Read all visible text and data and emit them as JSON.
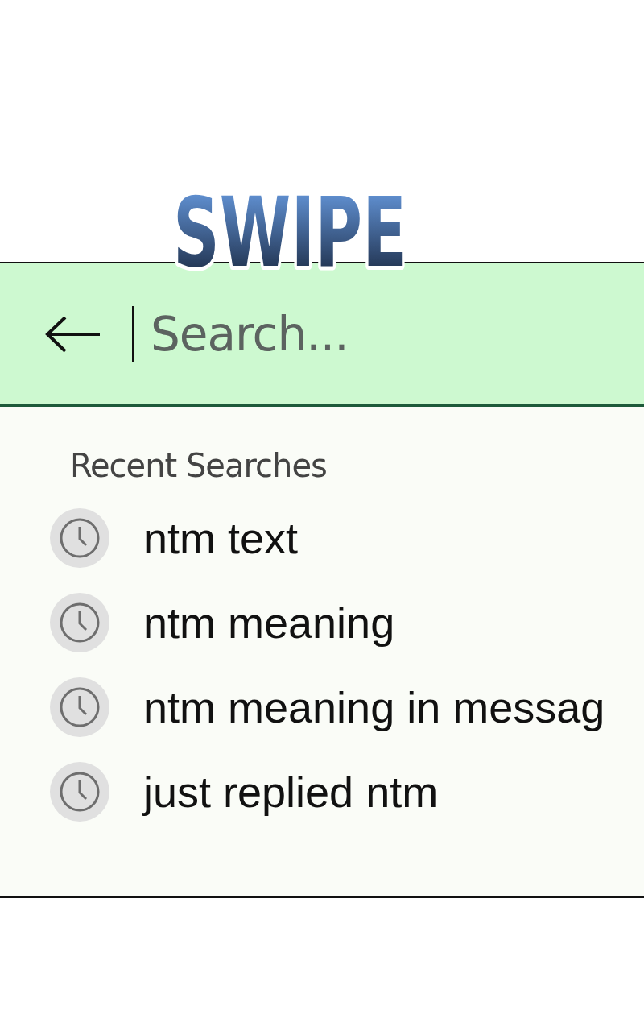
{
  "logo": {
    "text": "SWIPE"
  },
  "search": {
    "placeholder": "Search...",
    "focused": true
  },
  "recent": {
    "title": "Recent Searches",
    "items": [
      {
        "text": "ntm text"
      },
      {
        "text": "ntm meaning"
      },
      {
        "text": "ntm meaning in messag"
      },
      {
        "text": "just replied ntm"
      }
    ]
  }
}
